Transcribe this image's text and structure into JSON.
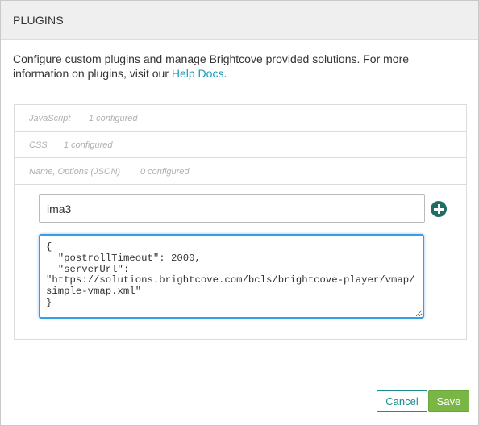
{
  "header": {
    "title": "PLUGINS"
  },
  "description": {
    "text": "Configure custom plugins and manage Brightcove provided solutions. For more information on plugins, visit our ",
    "link_label": "Help Docs",
    "suffix": "."
  },
  "plugin_sections": [
    {
      "label": "JavaScript",
      "count": "1 configured"
    },
    {
      "label": "CSS",
      "count": "1 configured"
    },
    {
      "label": "Name, Options (JSON)",
      "count": "0 configured"
    }
  ],
  "editor": {
    "name_value": "ima3",
    "options_value": "{\n  \"postrollTimeout\": 2000,\n  \"serverUrl\":\n\"https://solutions.brightcove.com/bcls/brightcove-player/vmap/simple-vmap.xml\"\n}",
    "add_icon": "plus-circle-icon"
  },
  "footer": {
    "cancel_label": "Cancel",
    "save_label": "Save"
  },
  "colors": {
    "link": "#1a9bb5",
    "add_button": "#1e6e63",
    "save_button": "#7ab646",
    "cancel_border": "#1a8c8c",
    "focus_border": "#3b9ce6"
  }
}
